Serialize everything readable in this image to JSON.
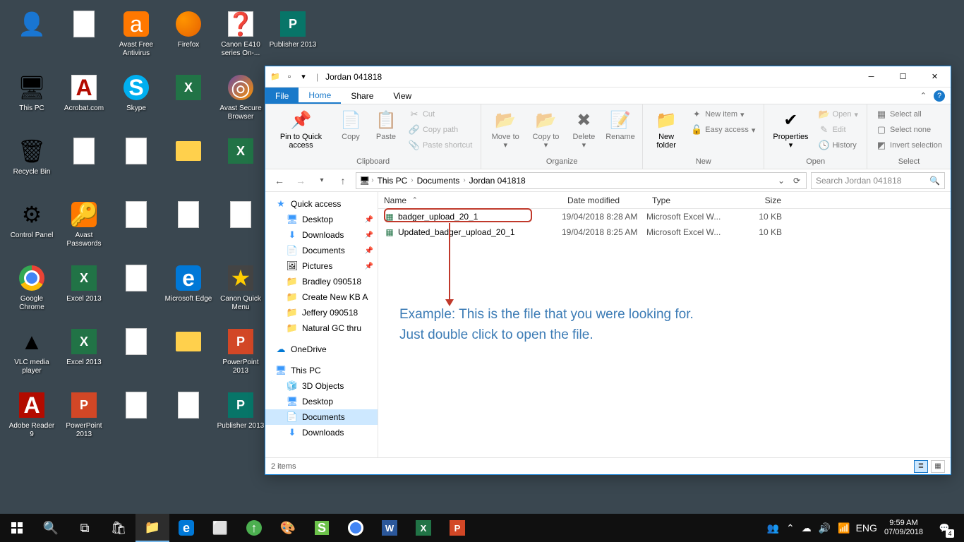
{
  "desktop": {
    "icons": [
      {
        "label": "",
        "glyph": "user"
      },
      {
        "label": "This PC",
        "glyph": "pc"
      },
      {
        "label": "Recycle Bin",
        "glyph": "recycle"
      },
      {
        "label": "Control Panel",
        "glyph": "control"
      },
      {
        "label": "Google Chrome",
        "glyph": "chrome"
      },
      {
        "label": "VLC media player",
        "glyph": "vlc"
      },
      {
        "label": "Adobe Reader 9",
        "glyph": "adobe"
      },
      {
        "label": "",
        "glyph": "doc"
      },
      {
        "label": "Acrobat.com",
        "glyph": "acrobat"
      },
      {
        "label": "",
        "glyph": "doc"
      },
      {
        "label": "Avast Passwords",
        "glyph": "avastkey"
      },
      {
        "label": "Excel 2013",
        "glyph": "excel"
      },
      {
        "label": "Excel 2013",
        "glyph": "excel"
      },
      {
        "label": "PowerPoint 2013",
        "glyph": "ppt"
      },
      {
        "label": "Avast Free Antivirus",
        "glyph": "avast"
      },
      {
        "label": "Skype",
        "glyph": "skype"
      },
      {
        "label": "",
        "glyph": "doc"
      },
      {
        "label": "",
        "glyph": "doc"
      },
      {
        "label": "",
        "glyph": "doc"
      },
      {
        "label": "",
        "glyph": "doc"
      },
      {
        "label": "",
        "glyph": "doc"
      },
      {
        "label": "Firefox",
        "glyph": "firefox"
      },
      {
        "label": "",
        "glyph": "excel"
      },
      {
        "label": "",
        "glyph": "folder"
      },
      {
        "label": "",
        "glyph": "doc"
      },
      {
        "label": "Microsoft Edge",
        "glyph": "edge"
      },
      {
        "label": "",
        "glyph": "folder"
      },
      {
        "label": "",
        "glyph": "doc"
      },
      {
        "label": "Canon E410 series On-...",
        "glyph": "canon"
      },
      {
        "label": "Avast Secure Browser",
        "glyph": "avastbrowser"
      },
      {
        "label": "",
        "glyph": "excel"
      },
      {
        "label": "",
        "glyph": "doc"
      },
      {
        "label": "Canon Quick Menu",
        "glyph": "canonmenu"
      },
      {
        "label": "PowerPoint 2013",
        "glyph": "ppt"
      },
      {
        "label": "Publisher 2013",
        "glyph": "pub"
      },
      {
        "label": "Publisher 2013",
        "glyph": "pub"
      }
    ]
  },
  "explorer": {
    "title": "Jordan 041818",
    "tabs": {
      "file": "File",
      "home": "Home",
      "share": "Share",
      "view": "View"
    },
    "ribbon": {
      "pin": "Pin to Quick access",
      "copy": "Copy",
      "paste": "Paste",
      "cut": "Cut",
      "copypath": "Copy path",
      "pastesc": "Paste shortcut",
      "clipboard": "Clipboard",
      "moveto": "Move to",
      "copyto": "Copy to",
      "delete": "Delete",
      "rename": "Rename",
      "organize": "Organize",
      "newfolder": "New folder",
      "newitem": "New item",
      "easyaccess": "Easy access",
      "new": "New",
      "properties": "Properties",
      "open": "Open",
      "edit": "Edit",
      "history": "History",
      "openg": "Open",
      "selall": "Select all",
      "selnone": "Select none",
      "invsel": "Invert selection",
      "select": "Select"
    },
    "breadcrumb": [
      "This PC",
      "Documents",
      "Jordan 041818"
    ],
    "search_placeholder": "Search Jordan 041818",
    "nav": {
      "quick": "Quick access",
      "desktop": "Desktop",
      "downloads": "Downloads",
      "documents": "Documents",
      "pictures": "Pictures",
      "f1": "Bradley 090518",
      "f2": "Create New KB A",
      "f3": "Jeffery 090518",
      "f4": "Natural GC thru",
      "onedrive": "OneDrive",
      "thispc": "This PC",
      "objects3d": "3D Objects",
      "desktop2": "Desktop",
      "documents2": "Documents",
      "downloads2": "Downloads"
    },
    "columns": {
      "name": "Name",
      "date": "Date modified",
      "type": "Type",
      "size": "Size"
    },
    "files": [
      {
        "name": "badger_upload_20_1",
        "date": "19/04/2018 8:28 AM",
        "type": "Microsoft Excel W...",
        "size": "10 KB"
      },
      {
        "name": "Updated_badger_upload_20_1",
        "date": "19/04/2018 8:25 AM",
        "type": "Microsoft Excel W...",
        "size": "10 KB"
      }
    ],
    "annotation": "Example: This is the file that you were looking for.\nJust double click to open the file.",
    "status": "2 items"
  },
  "taskbar": {
    "tray": {
      "lang": "ENG",
      "time": "9:59 AM",
      "date": "07/09/2018",
      "notif_count": "4"
    }
  }
}
